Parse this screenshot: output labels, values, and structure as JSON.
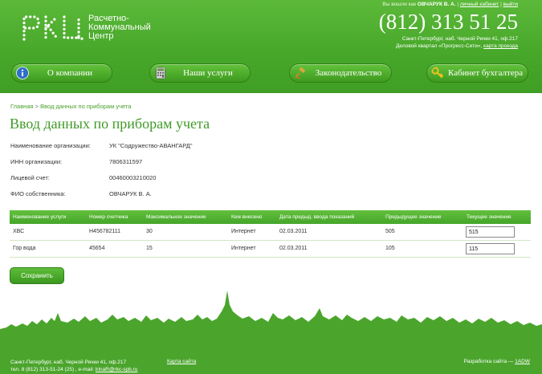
{
  "header": {
    "logo_text": [
      "Расчетно-",
      "Коммунальный",
      "Центр"
    ],
    "user_prefix": "Вы вошли как",
    "user_name": "ОВЧАРУК В. А.",
    "sep1": "|",
    "cabinet_link": "личный кабинет",
    "sep2": "|",
    "logout_link": "выйти",
    "phone": "(812) 313 51 25",
    "address_line1": "Санкт-Петербург, наб. Черной Речки 41, оф.217",
    "address_line2": "Деловой квартал «Прогресс-Сити»,",
    "map_link": "карта проезда"
  },
  "nav": [
    {
      "label": "О компании",
      "icon": "info-icon"
    },
    {
      "label": "Наши услуги",
      "icon": "calculator-icon"
    },
    {
      "label": "Законодательство",
      "icon": "gavel-icon"
    },
    {
      "label": "Кабинет бухгалтера",
      "icon": "key-icon"
    }
  ],
  "breadcrumb": {
    "home": "Главная",
    "sep": ">",
    "current": "Ввод данных по приборам учета"
  },
  "page_title": "Ввод данных по приборам учета",
  "info": [
    {
      "label": "Наименование организации:",
      "value": "УК \"Содружество-АВАНГАРД\""
    },
    {
      "label": "ИНН организации:",
      "value": "7806311597"
    },
    {
      "label": "Лицевой счет:",
      "value": "00460003210020"
    },
    {
      "label": "ФИО собственника:",
      "value": "ОВЧАРУК В. А."
    }
  ],
  "table": {
    "columns": [
      "Наименование услуги",
      "Номер счетчика",
      "Максимальное значение",
      "Кем внесено",
      "Дата предыд. ввода показаний",
      "Предыдущее значение",
      "Текущее значение"
    ],
    "rows": [
      {
        "service": "ХВС",
        "meter": "Н456782111",
        "max": "30",
        "by": "Интернет",
        "date": "02.03.2011",
        "prev": "505",
        "current": "515"
      },
      {
        "service": "Гор вода",
        "meter": "45654",
        "max": "15",
        "by": "Интернет",
        "date": "02.03.2011",
        "prev": "105",
        "current": "115"
      }
    ]
  },
  "save_label": "Сохранить",
  "footer": {
    "address": "Санкт-Петербург, наб. Черной Речки 41, оф.217",
    "contacts_prefix": "тел. 8 (812) 313-51-24 (25) , e-mail:",
    "email": "lrinaR@rkc-spb.ru",
    "map_link": "Карта сайта",
    "dev_prefix": "Разработка сайта —",
    "dev_link": "1ADW"
  },
  "colors": {
    "brand_green": "#4ba52d",
    "title_green": "#3f9a26"
  }
}
